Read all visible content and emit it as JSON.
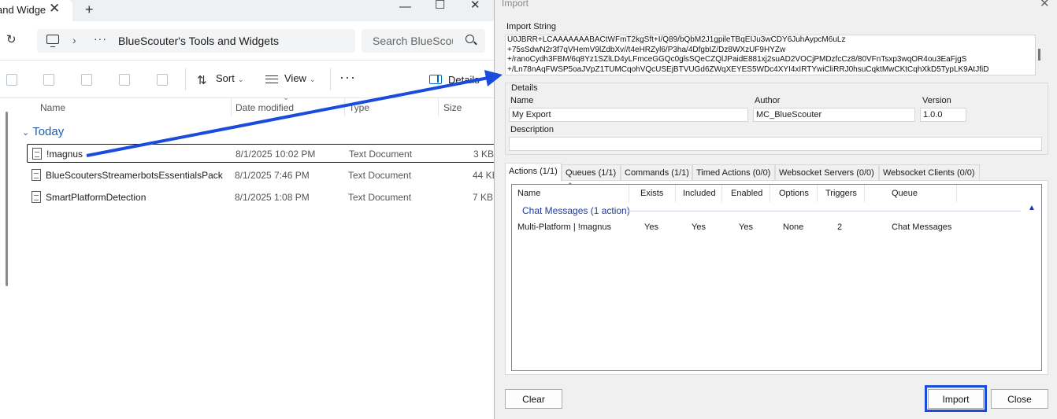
{
  "explorer": {
    "tab_title": "and Widge",
    "breadcrumb": "BlueScouter's Tools and Widgets",
    "search_placeholder": "Search BlueScou",
    "toolbar": {
      "sort_label": "Sort",
      "view_label": "View",
      "details_label": "Details"
    },
    "columns": {
      "name": "Name",
      "date": "Date modified",
      "type": "Type",
      "size": "Size"
    },
    "group_label": "Today",
    "files": [
      {
        "name": "!magnus",
        "date": "8/1/2025 10:02 PM",
        "type": "Text Document",
        "size": "3 KB"
      },
      {
        "name": "BlueScoutersStreamerbotsEssentialsPack",
        "date": "8/1/2025 7:46 PM",
        "type": "Text Document",
        "size": "44 KB"
      },
      {
        "name": "SmartPlatformDetection",
        "date": "8/1/2025 1:08 PM",
        "type": "Text Document",
        "size": "7 KB"
      }
    ]
  },
  "dialog": {
    "title": "Import",
    "import_string_label": "Import String",
    "import_string_lines": [
      "U0JBRR+LCAAAAAAABACtWFmT2kgSft+I/Q89/bQbM2J1gpileTBqEIJu3wCDY6JuhAypcM6uLz",
      "+75sSdwN2r3f7qVHemV9lZdbXv//t4eHRZyl6/P3ha/4DfgbIZ/Dz8WXzUF9HYZw",
      "+/ranoCydh3FBM/6q8Yz1SZlLD4yLFmceGGQc0glsSQeCZQlJPaidE881xj2suAD2VOCjPMDzfcCz8/80VFnTsxp3wqOR4ou3EaFjgS",
      "+/Ln78nAqFWSP5oaJVpZ1TUMCqohVQcUSEjBTVUGd6ZWqXEYES5WDc4XYI4xIRTYwiCliRRJ0hsuCqktMwCKtCqhXkD5TypLK9AtJfiD"
    ],
    "details_label": "Details",
    "name_label": "Name",
    "name_value": "My Export",
    "author_label": "Author",
    "author_value": "MC_BlueScouter",
    "version_label": "Version",
    "version_value": "1.0.0",
    "description_label": "Description",
    "description_value": "",
    "tabs": [
      "Actions (1/1)",
      "Queues (1/1)",
      "Commands (1/1)",
      "Timed Actions (0/0)",
      "Websocket Servers (0/0)",
      "Websocket Clients (0/0)"
    ],
    "list_headers": {
      "name": "Name",
      "exists": "Exists",
      "included": "Included",
      "enabled": "Enabled",
      "options": "Options",
      "triggers": "Triggers",
      "queue": "Queue"
    },
    "group_label": "Chat Messages (1 action)",
    "row": {
      "name": "Multi-Platform | !magnus",
      "exists": "Yes",
      "included": "Yes",
      "enabled": "Yes",
      "options": "None",
      "triggers": "2",
      "queue": "Chat Messages"
    },
    "buttons": {
      "clear": "Clear",
      "import": "Import",
      "close": "Close"
    }
  },
  "colors": {
    "annotation_blue": "#1a4bdc",
    "group_text": "#1e3b9b",
    "explorer_group": "#1a5fb4"
  }
}
